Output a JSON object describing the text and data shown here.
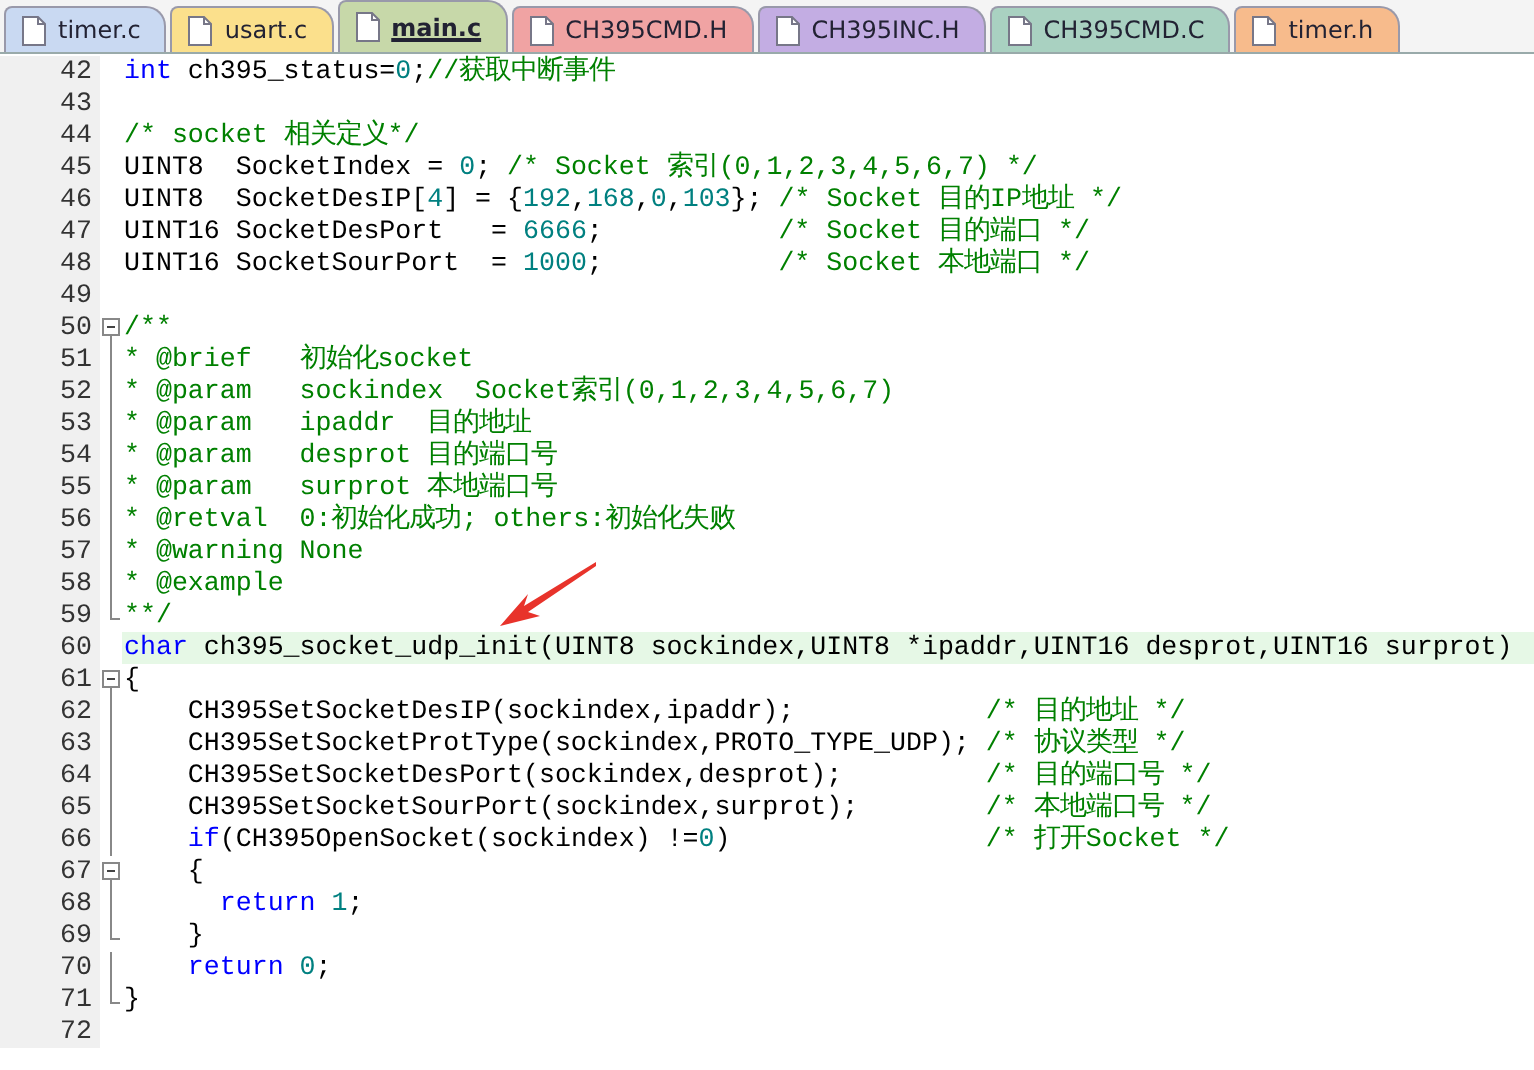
{
  "tabs": [
    {
      "label": "timer.c",
      "selected": false,
      "color": "#c9d9f2"
    },
    {
      "label": "usart.c",
      "selected": false,
      "color": "#fbe08c"
    },
    {
      "label": "main.c",
      "selected": true,
      "color": "#c7d8a9"
    },
    {
      "label": "CH395CMD.H",
      "selected": false,
      "color": "#f0a3a3"
    },
    {
      "label": "CH395INC.H",
      "selected": false,
      "color": "#c3ade3"
    },
    {
      "label": "CH395CMD.C",
      "selected": false,
      "color": "#a9d1c1"
    },
    {
      "label": "timer.h",
      "selected": false,
      "color": "#f7bb8c"
    }
  ],
  "lines": [
    {
      "number": "42",
      "highlighted": false,
      "tokens": [
        {
          "kind": "keyword",
          "text": "int"
        },
        {
          "kind": "text",
          "text": " ch395_status="
        },
        {
          "kind": "number",
          "text": "0"
        },
        {
          "kind": "text",
          "text": ";"
        },
        {
          "kind": "comment",
          "text": "//获取中断事件"
        }
      ]
    },
    {
      "number": "43",
      "highlighted": false
    },
    {
      "number": "44",
      "highlighted": false,
      "tokens": [
        {
          "kind": "comment",
          "text": "/* socket 相关定义*/"
        }
      ]
    },
    {
      "number": "45",
      "highlighted": false,
      "tokens": [
        {
          "kind": "text",
          "text": "UINT8  SocketIndex = "
        },
        {
          "kind": "number",
          "text": "0"
        },
        {
          "kind": "text",
          "text": "; "
        },
        {
          "kind": "comment",
          "text": "/* Socket 索引(0,1,2,3,4,5,6,7) */"
        }
      ]
    },
    {
      "number": "46",
      "highlighted": false,
      "tokens": [
        {
          "kind": "text",
          "text": "UINT8  SocketDesIP["
        },
        {
          "kind": "number",
          "text": "4"
        },
        {
          "kind": "text",
          "text": "] = {"
        },
        {
          "kind": "number",
          "text": "192"
        },
        {
          "kind": "text",
          "text": ","
        },
        {
          "kind": "number",
          "text": "168"
        },
        {
          "kind": "text",
          "text": ","
        },
        {
          "kind": "number",
          "text": "0"
        },
        {
          "kind": "text",
          "text": ","
        },
        {
          "kind": "number",
          "text": "103"
        },
        {
          "kind": "text",
          "text": "}; "
        },
        {
          "kind": "comment",
          "text": "/* Socket 目的IP地址 */"
        }
      ]
    },
    {
      "number": "47",
      "highlighted": false,
      "tokens": [
        {
          "kind": "text",
          "text": "UINT16 SocketDesPort   = "
        },
        {
          "kind": "number",
          "text": "6666"
        },
        {
          "kind": "text",
          "text": ";           "
        },
        {
          "kind": "comment",
          "text": "/* Socket 目的端口 */"
        }
      ]
    },
    {
      "number": "48",
      "highlighted": false,
      "tokens": [
        {
          "kind": "text",
          "text": "UINT16 SocketSourPort  = "
        },
        {
          "kind": "number",
          "text": "1000"
        },
        {
          "kind": "text",
          "text": ";           "
        },
        {
          "kind": "comment",
          "text": "/* Socket 本地端口 */"
        }
      ]
    },
    {
      "number": "49",
      "highlighted": false
    },
    {
      "number": "50",
      "highlighted": false,
      "kind": "start",
      "tokens": [
        {
          "kind": "comment",
          "text": "/**"
        }
      ]
    },
    {
      "number": "51",
      "highlighted": false,
      "kind": "body",
      "tokens": [
        {
          "kind": "comment",
          "text": "* @brief   初始化socket"
        }
      ]
    },
    {
      "number": "52",
      "highlighted": false,
      "kind": "body",
      "tokens": [
        {
          "kind": "comment",
          "text": "* @param   sockindex  Socket索引(0,1,2,3,4,5,6,7)"
        }
      ]
    },
    {
      "number": "53",
      "highlighted": false,
      "kind": "body",
      "tokens": [
        {
          "kind": "comment",
          "text": "* @param   ipaddr  目的地址"
        }
      ]
    },
    {
      "number": "54",
      "highlighted": false,
      "kind": "body",
      "tokens": [
        {
          "kind": "comment",
          "text": "* @param   desprot 目的端口号"
        }
      ]
    },
    {
      "number": "55",
      "highlighted": false,
      "kind": "body",
      "tokens": [
        {
          "kind": "comment",
          "text": "* @param   surprot 本地端口号"
        }
      ]
    },
    {
      "number": "56",
      "highlighted": false,
      "kind": "body",
      "tokens": [
        {
          "kind": "comment",
          "text": "* @retval  0:初始化成功; others:初始化失败"
        }
      ]
    },
    {
      "number": "57",
      "highlighted": false,
      "kind": "body",
      "tokens": [
        {
          "kind": "comment",
          "text": "* @warning None"
        }
      ]
    },
    {
      "number": "58",
      "highlighted": false,
      "kind": "body",
      "tokens": [
        {
          "kind": "comment",
          "text": "* @example"
        }
      ]
    },
    {
      "number": "59",
      "highlighted": false,
      "kind": "end",
      "tokens": [
        {
          "kind": "comment",
          "text": "**/"
        }
      ]
    },
    {
      "number": "60",
      "highlighted": true,
      "tokens": [
        {
          "kind": "keyword",
          "text": "char"
        },
        {
          "kind": "text",
          "text": " ch395_socket_udp_init(UINT8 sockindex,UINT8 *ipaddr,UINT16 desprot,UINT16 surprot)"
        }
      ]
    },
    {
      "number": "61",
      "highlighted": false,
      "kind": "start",
      "tokens": [
        {
          "kind": "text",
          "text": "{"
        }
      ]
    },
    {
      "number": "62",
      "highlighted": false,
      "kind": "body",
      "tokens": [
        {
          "kind": "text",
          "text": "    CH395SetSocketDesIP(sockindex,ipaddr);            "
        },
        {
          "kind": "comment",
          "text": "/* 目的地址 */"
        }
      ]
    },
    {
      "number": "63",
      "highlighted": false,
      "kind": "body",
      "tokens": [
        {
          "kind": "text",
          "text": "    CH395SetSocketProtType(sockindex,PROTO_TYPE_UDP); "
        },
        {
          "kind": "comment",
          "text": "/* 协议类型 */"
        }
      ]
    },
    {
      "number": "64",
      "highlighted": false,
      "kind": "body",
      "tokens": [
        {
          "kind": "text",
          "text": "    CH395SetSocketDesPort(sockindex,desprot);         "
        },
        {
          "kind": "comment",
          "text": "/* 目的端口号 */"
        }
      ]
    },
    {
      "number": "65",
      "highlighted": false,
      "kind": "body",
      "tokens": [
        {
          "kind": "text",
          "text": "    CH395SetSocketSourPort(sockindex,surprot);        "
        },
        {
          "kind": "comment",
          "text": "/* 本地端口号 */"
        }
      ]
    },
    {
      "number": "66",
      "highlighted": false,
      "kind": "body",
      "tokens": [
        {
          "kind": "keyword",
          "text": "    if"
        },
        {
          "kind": "text",
          "text": "(CH395OpenSocket(sockindex) !="
        },
        {
          "kind": "number",
          "text": "0"
        },
        {
          "kind": "text",
          "text": ")                "
        },
        {
          "kind": "comment",
          "text": "/* 打开Socket */"
        }
      ]
    },
    {
      "number": "67",
      "highlighted": false,
      "kind": "start",
      "tokens": [
        {
          "kind": "text",
          "text": "    {"
        }
      ]
    },
    {
      "number": "68",
      "highlighted": false,
      "kind": "body",
      "tokens": [
        {
          "kind": "keyword",
          "text": "      return"
        },
        {
          "kind": "number",
          "text": " 1"
        },
        {
          "kind": "text",
          "text": ";"
        }
      ]
    },
    {
      "number": "69",
      "highlighted": false,
      "kind": "end",
      "tokens": [
        {
          "kind": "text",
          "text": "    }"
        }
      ]
    },
    {
      "number": "70",
      "highlighted": false,
      "kind": "body",
      "tokens": [
        {
          "kind": "keyword",
          "text": "    return"
        },
        {
          "kind": "number",
          "text": " 0"
        },
        {
          "kind": "text",
          "text": ";"
        }
      ]
    },
    {
      "number": "71",
      "highlighted": false,
      "kind": "end",
      "tokens": [
        {
          "kind": "text",
          "text": "}"
        }
      ]
    },
    {
      "number": "72",
      "highlighted": false
    }
  ]
}
